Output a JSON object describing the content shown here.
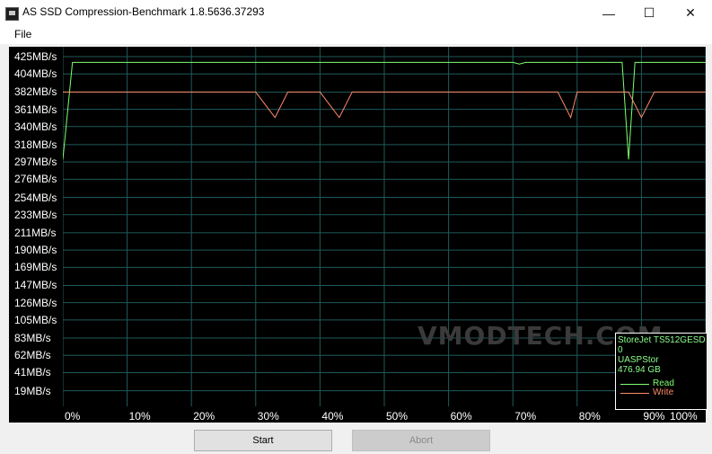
{
  "window": {
    "title": "AS SSD Compression-Benchmark 1.8.5636.37293",
    "minimize_glyph": "—",
    "maximize_glyph": "☐",
    "close_glyph": "✕"
  },
  "menu": {
    "file_label": "File"
  },
  "watermark": "VMODTECH.COM",
  "legend": {
    "device_lines": [
      "StoreJet TS512GESD",
      "0",
      "UASPStor",
      "476.94 GB"
    ],
    "read_label": "Read",
    "write_label": "Write"
  },
  "buttons": {
    "start_label": "Start",
    "abort_label": "Abort"
  },
  "colors": {
    "read": "#7dff6e",
    "write": "#ff8a6a",
    "grid": "#1f5a5a",
    "background": "#000000"
  },
  "chart_data": {
    "type": "line",
    "title": "",
    "xlabel": "",
    "ylabel": "",
    "xlim": [
      0,
      100
    ],
    "ylim": [
      0,
      425
    ],
    "y_ticks": [
      425,
      404,
      382,
      361,
      340,
      318,
      297,
      276,
      254,
      233,
      211,
      190,
      169,
      147,
      126,
      105,
      83,
      62,
      41,
      19
    ],
    "y_tick_labels": [
      "425MB/s",
      "404MB/s",
      "382MB/s",
      "361MB/s",
      "340MB/s",
      "318MB/s",
      "297MB/s",
      "276MB/s",
      "254MB/s",
      "233MB/s",
      "211MB/s",
      "190MB/s",
      "169MB/s",
      "147MB/s",
      "126MB/s",
      "105MB/s",
      "83MB/s",
      "62MB/s",
      "41MB/s",
      "19MB/s"
    ],
    "x_ticks": [
      0,
      10,
      20,
      30,
      40,
      50,
      60,
      70,
      80,
      90,
      100
    ],
    "x_tick_labels": [
      "0%",
      "10%",
      "20%",
      "30%",
      "40%",
      "50%",
      "60%",
      "70%",
      "80%",
      "90%",
      "100%"
    ],
    "grid": true,
    "legend_position": "bottom-right",
    "series": [
      {
        "name": "Read",
        "x": [
          0,
          1.5,
          10,
          30,
          50,
          60,
          70,
          71,
          72,
          80,
          86,
          87,
          88,
          89,
          90,
          100
        ],
        "y": [
          300,
          418,
          418,
          418,
          418,
          418,
          418,
          416,
          418,
          418,
          418,
          418,
          300,
          418,
          418,
          418
        ]
      },
      {
        "name": "Write",
        "x": [
          0,
          5,
          20,
          30,
          33,
          35,
          40,
          43,
          45,
          50,
          60,
          70,
          77,
          79,
          80,
          88,
          90,
          92,
          100
        ],
        "y": [
          382,
          382,
          382,
          382,
          351,
          382,
          382,
          351,
          382,
          382,
          382,
          382,
          382,
          351,
          382,
          382,
          351,
          382,
          382
        ]
      }
    ]
  }
}
